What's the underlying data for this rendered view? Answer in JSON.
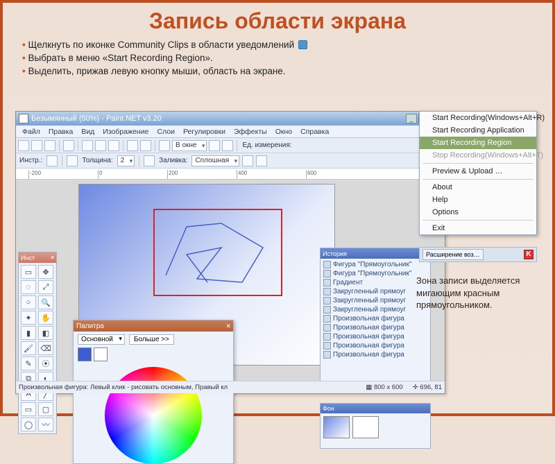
{
  "slide": {
    "title": "Запись области экрана",
    "bullets": [
      "Щелкнуть по иконке    Community Clips в области уведомлений",
      "Выбрать в меню «Start Recording Region».",
      "Выделить, прижав левую кнопку мыши, область на экране."
    ],
    "caption": "Зона записи выделяется мигающим красным прямоугольником."
  },
  "app": {
    "title": "Безымянный (50%) - Paint.NET v3.20",
    "menus": [
      "Файл",
      "Правка",
      "Вид",
      "Изображение",
      "Слои",
      "Регулировки",
      "Эффекты",
      "Окно",
      "Справка"
    ],
    "toolbar2": {
      "instr_label": "Инстр.:",
      "thickness_label": "Толщина:",
      "thickness_value": "2",
      "fill_label": "Заливка:",
      "fill_value": "Сплошная"
    },
    "toolbar_extra": {
      "vokne": "В окне",
      "units_label": "Ед. измерения:"
    },
    "ruler_ticks": [
      "-200",
      "0",
      "200",
      "400",
      "600"
    ],
    "statusbar": {
      "hint": "Произвольная фигура: Левый клик - рисовать основным, Правый кл",
      "size": "800 x 600",
      "cursor": "696, 81"
    }
  },
  "toolwin": {
    "title": "Инст"
  },
  "palette": {
    "title": "Палитра",
    "mode": "Основной",
    "more": "Больше >>",
    "swatches": [
      "#3b5fd1",
      "#ffffff"
    ]
  },
  "history": {
    "title": "История",
    "items": [
      "Фигура \"Прямоугольник\"",
      "Фигура \"Прямоугольник\"",
      "Градиент",
      "Закругленный прямоуг",
      "Закругленный прямоуг",
      "Закругленный прямоуг",
      "Произвольная фигура",
      "Произвольная фигура",
      "Произвольная фигура",
      "Произвольная фигура",
      "Произвольная фигура"
    ]
  },
  "layers": {
    "title": "Фон"
  },
  "ctxmenu": {
    "items": [
      {
        "label": "Start Recording(Windows+Alt+R)",
        "sel": false,
        "dis": false
      },
      {
        "label": "Start Recording Application",
        "sel": false,
        "dis": false
      },
      {
        "label": "Start Recording Region",
        "sel": true,
        "dis": false
      },
      {
        "label": "Stop Recording(Windows+Alt+T)",
        "sel": false,
        "dis": true
      },
      {
        "sep": true
      },
      {
        "label": "Preview & Upload …",
        "sel": false,
        "dis": false
      },
      {
        "sep": true
      },
      {
        "label": "About",
        "sel": false,
        "dis": false
      },
      {
        "label": "Help",
        "sel": false,
        "dis": false
      },
      {
        "label": "Options",
        "sel": false,
        "dis": false
      },
      {
        "sep": true
      },
      {
        "label": "Exit",
        "sel": false,
        "dis": false
      }
    ]
  },
  "taskbar": {
    "label": "Расширение воз…"
  }
}
